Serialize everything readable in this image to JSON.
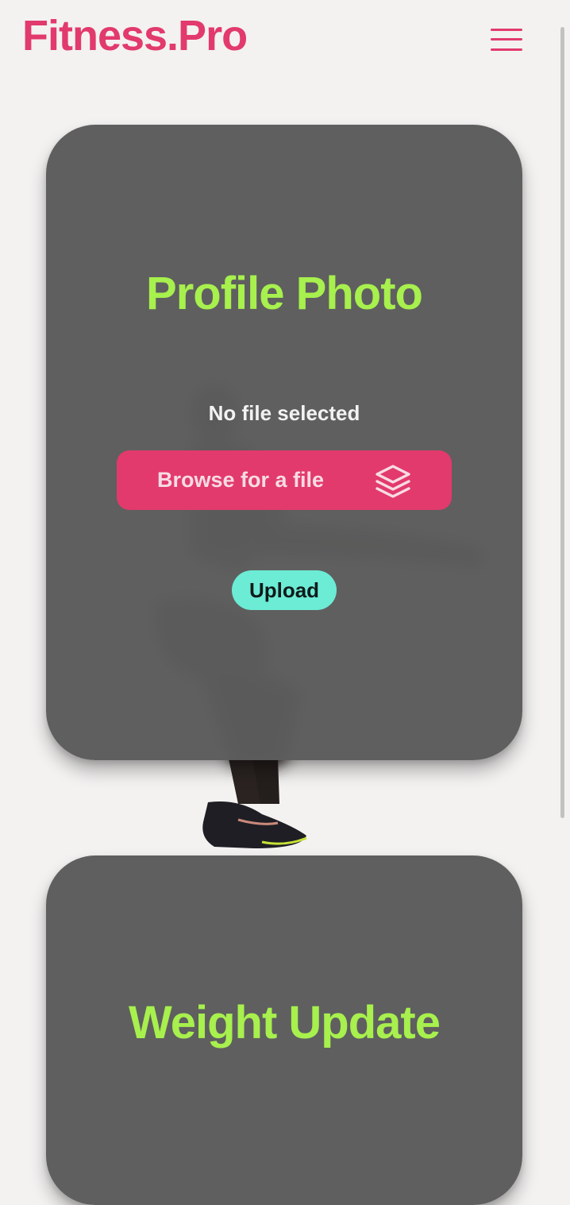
{
  "header": {
    "brand": "Fitness.Pro",
    "menu_icon": "hamburger-menu-icon"
  },
  "profile_card": {
    "title": "Profile Photo",
    "file_status": "No file selected",
    "browse_label": "Browse for a file",
    "browse_icon": "layers-icon",
    "upload_label": "Upload"
  },
  "weight_card": {
    "title": "Weight Update"
  },
  "background": {
    "image": "athlete-squat-image"
  },
  "colors": {
    "brand": "#e23a6d",
    "title_accent": "#a7f04d",
    "upload_button": "#6cebd5",
    "card_background": "#5c5c5c",
    "page_background": "#f3f2f1"
  }
}
